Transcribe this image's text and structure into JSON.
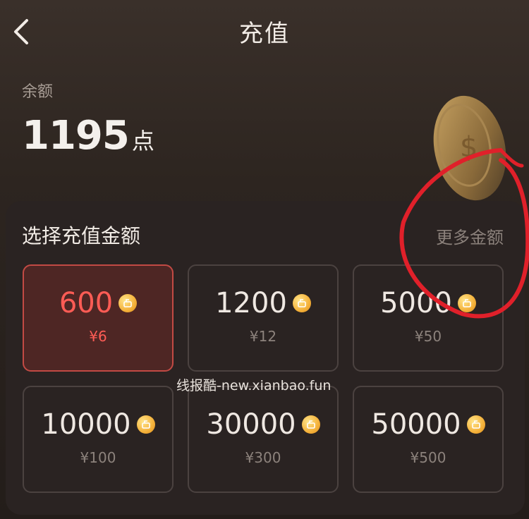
{
  "header": {
    "title": "充值",
    "back_icon": "chevron-left-icon"
  },
  "balance": {
    "label": "余额",
    "value": "1195",
    "unit": "点"
  },
  "recharge": {
    "title": "选择充值金额",
    "more_label": "更多金额",
    "options": [
      {
        "amount": "600",
        "price": "¥6",
        "selected": true
      },
      {
        "amount": "1200",
        "price": "¥12",
        "selected": false
      },
      {
        "amount": "5000",
        "price": "¥50",
        "selected": false
      },
      {
        "amount": "10000",
        "price": "¥100",
        "selected": false
      },
      {
        "amount": "30000",
        "price": "¥300",
        "selected": false
      },
      {
        "amount": "50000",
        "price": "¥500",
        "selected": false
      }
    ]
  },
  "watermark": "线报酷-new.xianbao.fun",
  "colors": {
    "accent": "#ff5c55",
    "coin": "#f4b13a",
    "annotation": "#e0202a"
  }
}
